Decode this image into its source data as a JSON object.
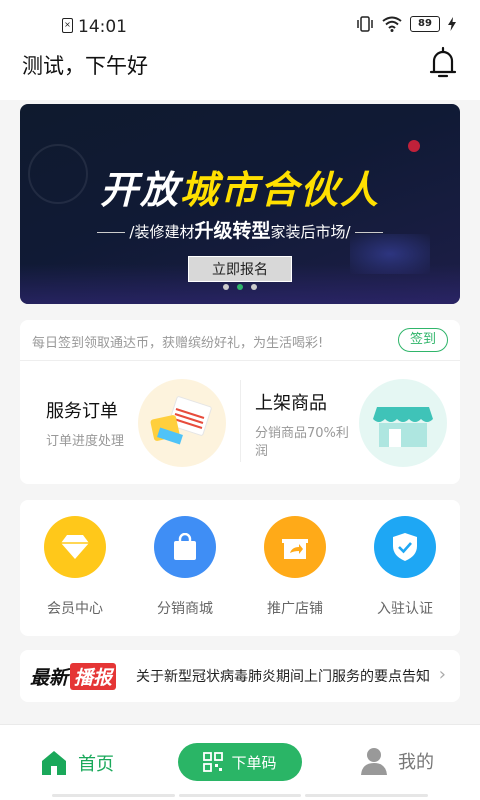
{
  "status_bar": {
    "time": "14:01",
    "battery": "89"
  },
  "header": {
    "greeting": "测试，下午好"
  },
  "banner": {
    "title_part1": "开放",
    "title_part2": "城市合伙人",
    "sub_left": "/装修建材",
    "sub_strong": "升级转型",
    "sub_right": "家装后市场/",
    "button_label": "立即报名",
    "dots": 3,
    "active_dot": 1
  },
  "checkin": {
    "text": "每日签到领取通达币，获赠缤纷好礼，为生活喝彩!",
    "button_label": "签到"
  },
  "services": [
    {
      "title": "服务订单",
      "subtitle": "订单进度处理"
    },
    {
      "title": "上架商品",
      "subtitle": "分销商品70%利润"
    }
  ],
  "menu": [
    {
      "label": "会员中心",
      "icon": "diamond-icon",
      "color": "#ffc81a"
    },
    {
      "label": "分销商城",
      "icon": "shopping-bag-icon",
      "color": "#3f8ef5"
    },
    {
      "label": "推广店铺",
      "icon": "share-store-icon",
      "color": "#ffaa18"
    },
    {
      "label": "入驻认证",
      "icon": "shield-check-icon",
      "color": "#1ea7f4"
    }
  ],
  "news": {
    "badge_left": "最新",
    "badge_right": "播报",
    "text": "关于新型冠状病毒肺炎期间上门服务的要点告知"
  },
  "tabbar": {
    "home": "首页",
    "order": "下单码",
    "mine": "我的"
  },
  "colors": {
    "accent": "#2fb56a"
  }
}
